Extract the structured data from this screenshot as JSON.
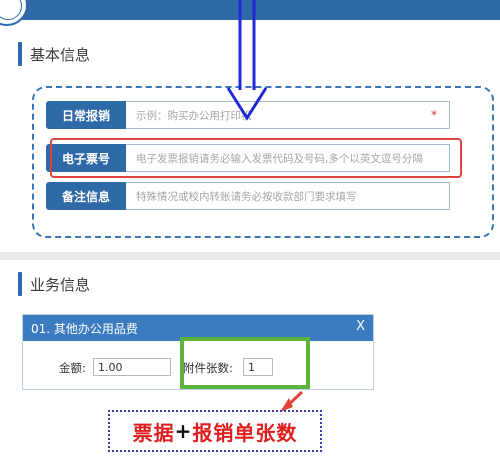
{
  "section_basic": {
    "title": "基本信息"
  },
  "fields": [
    {
      "label": "日常报销",
      "placeholder": "示例：购买办公用打印机",
      "required": "*"
    },
    {
      "label": "电子票号",
      "placeholder": "电子发票报销请务必输入发票代码及号码,多个以英文逗号分隔"
    },
    {
      "label": "备注信息",
      "placeholder": "特殊情况或校内转账请务必按收款部门要求填写"
    }
  ],
  "section_business": {
    "title": "业务信息"
  },
  "panel": {
    "title": "01. 其他办公用品费",
    "close": "X",
    "amount_label": "金额:",
    "amount_value": "1.00",
    "attach_label": "附件张数:",
    "attach_value": "1"
  },
  "caption": {
    "part1": "票据",
    "plus": "+",
    "part2": "报销单张数"
  },
  "colors": {
    "accent": "#2f6aa8",
    "blue_arrow": "#1f2ad6",
    "red_highlight": "#e0453a",
    "green_highlight": "#5bb33a"
  }
}
